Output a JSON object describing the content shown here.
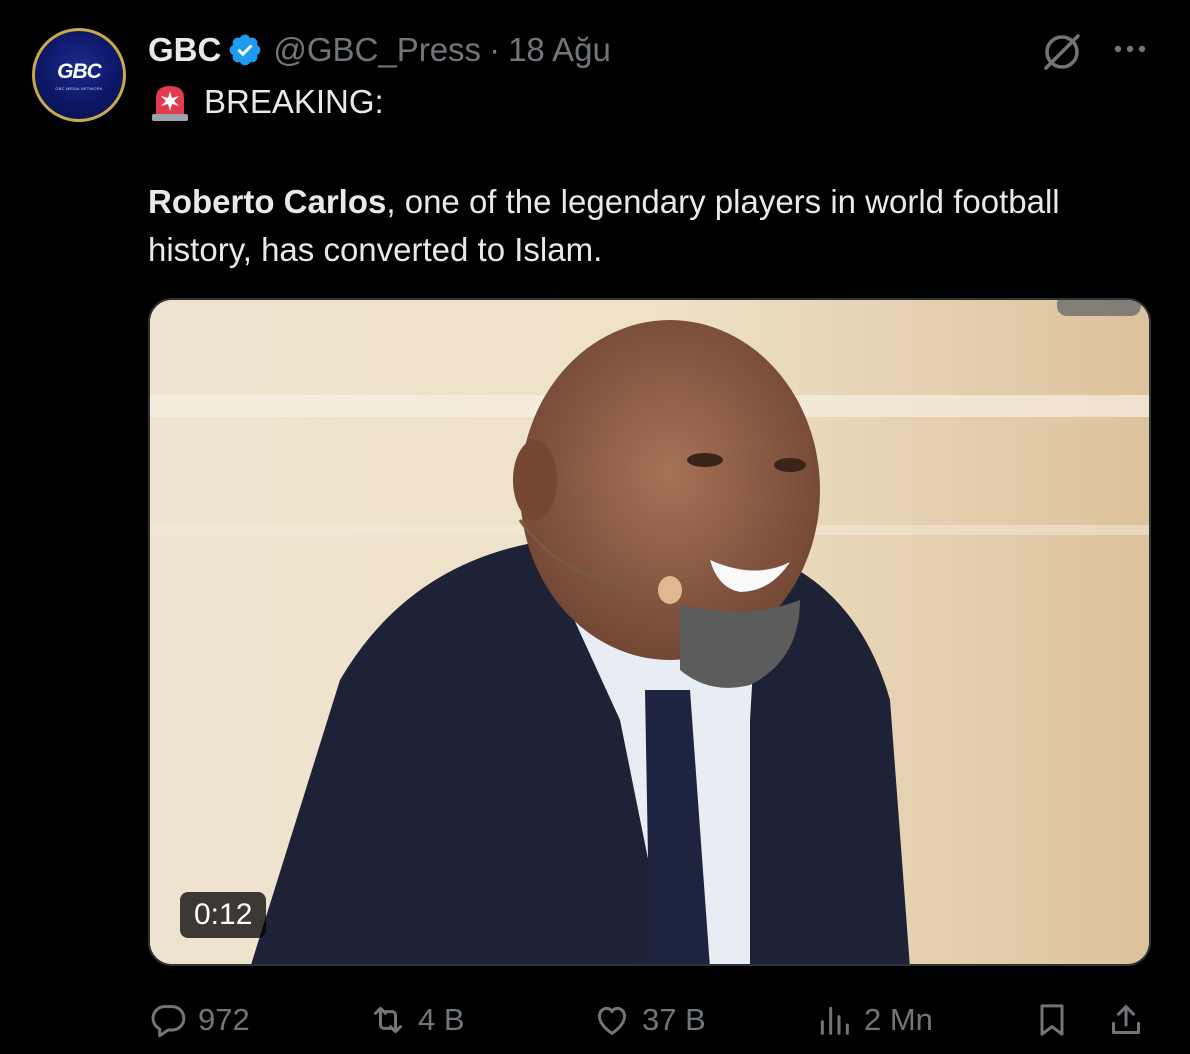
{
  "account": {
    "avatar_text": "GBC",
    "avatar_subtext": "GBC MEDIA NETWORK",
    "name": "GBC",
    "handle": "@GBC_Press",
    "separator": "·",
    "date": "18 Ağu"
  },
  "post": {
    "breaking_label": "BREAKING:",
    "bold_name": "Roberto Carlos",
    "text_rest": ", one of the legendary players in world football history, has converted to Islam."
  },
  "media": {
    "duration": "0:12"
  },
  "actions": {
    "replies": "972",
    "reposts": "4 B",
    "likes": "37 B",
    "views": "2 Mn"
  },
  "colors": {
    "background": "#000000",
    "text": "#e7e9ea",
    "muted": "#71767b",
    "verified": "#1d9bf0",
    "border": "#2f3336"
  },
  "icons": [
    "verified-badge-icon",
    "grok-icon",
    "more-icon",
    "siren-icon",
    "reply-icon",
    "retweet-icon",
    "like-icon",
    "views-icon",
    "bookmark-icon",
    "share-icon"
  ]
}
